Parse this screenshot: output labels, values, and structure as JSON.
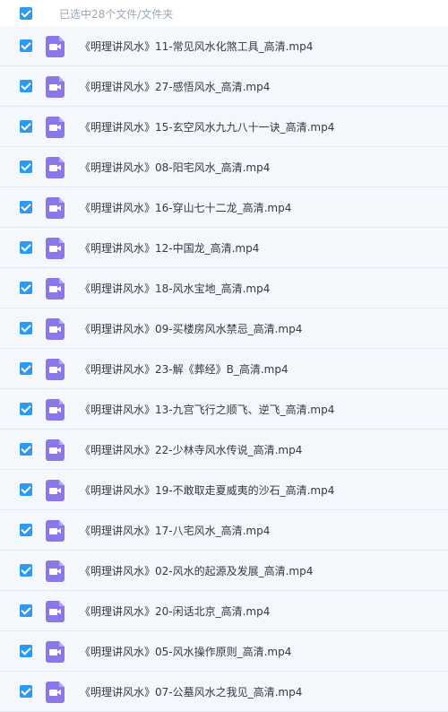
{
  "header": {
    "selection_text": "已选中28个文件/文件夹"
  },
  "files": [
    {
      "name": "《明理讲风水》11-常见风水化煞工具_高清.mp4",
      "icon": "video-file-icon"
    },
    {
      "name": "《明理讲风水》27-感悟风水_高清.mp4",
      "icon": "video-file-icon"
    },
    {
      "name": "《明理讲风水》15-玄空风水九九八十一诀_高清.mp4",
      "icon": "video-file-icon"
    },
    {
      "name": "《明理讲风水》08-阳宅风水_高清.mp4",
      "icon": "video-file-icon"
    },
    {
      "name": "《明理讲风水》16-穿山七十二龙_高清.mp4",
      "icon": "video-file-icon"
    },
    {
      "name": "《明理讲风水》12-中国龙_高清.mp4",
      "icon": "video-file-icon"
    },
    {
      "name": "《明理讲风水》18-风水宝地_高清.mp4",
      "icon": "video-file-icon"
    },
    {
      "name": "《明理讲风水》09-买楼房风水禁忌_高清.mp4",
      "icon": "video-file-icon"
    },
    {
      "name": "《明理讲风水》23-解《葬经》B_高清.mp4",
      "icon": "video-file-icon"
    },
    {
      "name": "《明理讲风水》13-九宫飞行之顺飞、逆飞_高清.mp4",
      "icon": "video-file-icon"
    },
    {
      "name": "《明理讲风水》22-少林寺风水传说_高清.mp4",
      "icon": "video-file-icon"
    },
    {
      "name": "《明理讲风水》19-不敢取走夏威夷的沙石_高清.mp4",
      "icon": "video-file-icon"
    },
    {
      "name": "《明理讲风水》17-八宅风水_高清.mp4",
      "icon": "video-file-icon"
    },
    {
      "name": "《明理讲风水》02-风水的起源及发展_高清.mp4",
      "icon": "video-file-icon"
    },
    {
      "name": "《明理讲风水》20-闲话北京_高清.mp4",
      "icon": "video-file-icon"
    },
    {
      "name": "《明理讲风水》05-风水操作原则_高清.mp4",
      "icon": "video-file-icon"
    },
    {
      "name": "《明理讲风水》07-公墓风水之我见_高清.mp4",
      "icon": "video-file-icon"
    }
  ],
  "colors": {
    "checkbox": "#2b9af3",
    "video_icon": "#8b77e8",
    "row_background": "#f4f8fc"
  }
}
